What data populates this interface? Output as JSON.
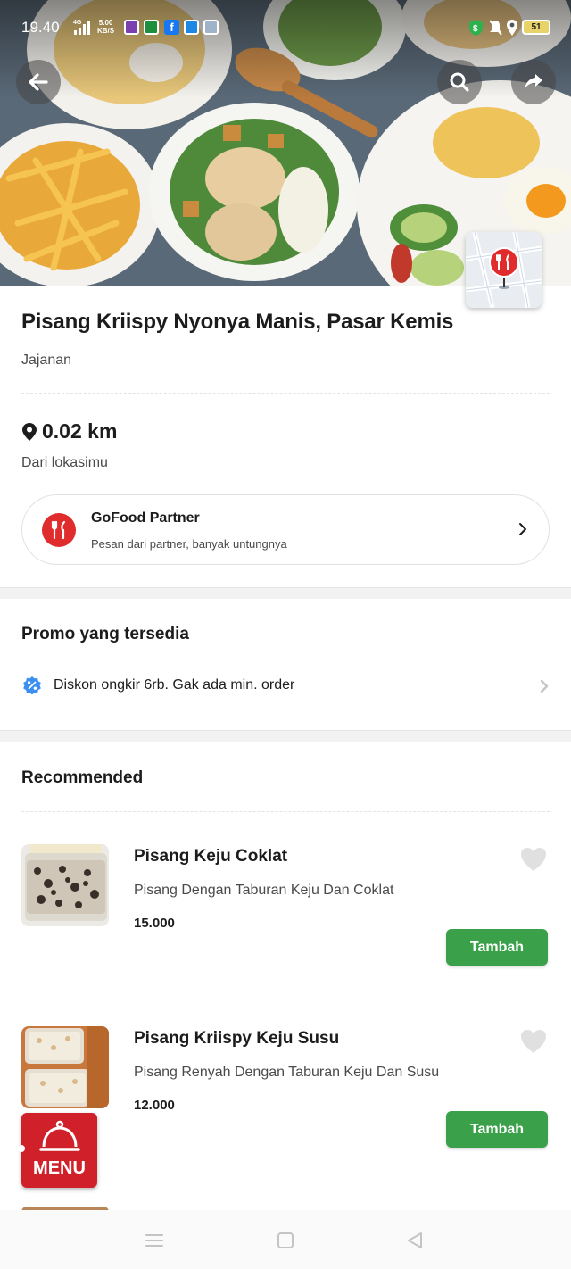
{
  "status_bar": {
    "time": "19.40",
    "network": "4G",
    "speed_value": "5.00",
    "speed_unit": "KB/S",
    "battery": "51"
  },
  "hero": {
    "back_icon": "arrow-left-icon",
    "search_icon": "search-icon",
    "share_icon": "share-icon",
    "map_icon": "map-pin-icon"
  },
  "restaurant": {
    "name": "Pisang Kriispy Nyonya Manis, Pasar Kemis",
    "category": "Jajanan",
    "distance": "0.02 km",
    "distance_sub": "Dari lokasimu"
  },
  "partner": {
    "title": "GoFood Partner",
    "description": "Pesan dari partner, banyak untungnya"
  },
  "promo": {
    "section_title": "Promo yang tersedia",
    "items": [
      {
        "text": "Diskon ongkir 6rb. Gak ada min. order"
      }
    ]
  },
  "recommended": {
    "section_title": "Recommended",
    "items": [
      {
        "name": "Pisang Keju Coklat",
        "description": "Pisang Dengan Taburan Keju Dan Coklat",
        "price": "15.000",
        "button": "Tambah"
      },
      {
        "name": "Pisang Kriispy Keju Susu",
        "description": "Pisang Renyah Dengan Taburan Keju Dan Susu",
        "price": "12.000",
        "button": "Tambah"
      }
    ]
  },
  "menu_fab": {
    "label": "MENU"
  },
  "colors": {
    "accent_green": "#3aa14a",
    "brand_red": "#e02c2c",
    "promo_blue": "#3b8ff0"
  }
}
